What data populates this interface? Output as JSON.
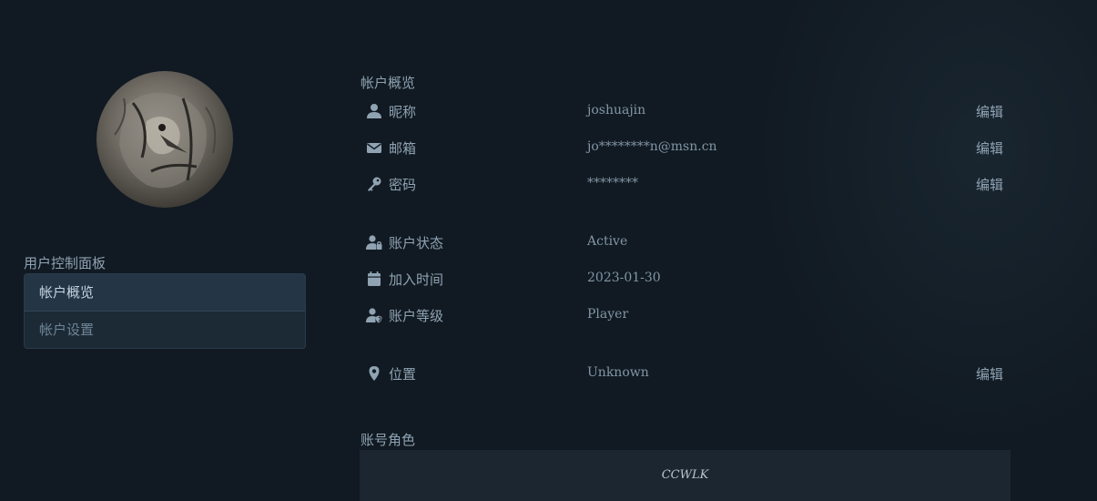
{
  "sidebar": {
    "panel_title": "用户控制面板",
    "items": [
      {
        "label": "帐户概览",
        "active": true
      },
      {
        "label": "帐户设置",
        "active": false
      }
    ]
  },
  "overview": {
    "title": "帐户概览",
    "edit_label": "编辑",
    "rows": [
      {
        "icon": "user-icon",
        "label": "昵称",
        "value": "joshuajin",
        "editable": true
      },
      {
        "icon": "envelope-icon",
        "label": "邮箱",
        "value": "jo********n@msn.cn",
        "editable": true
      },
      {
        "icon": "key-icon",
        "label": "密码",
        "value": "********",
        "editable": true
      },
      {
        "icon": "user-lock-icon",
        "label": "账户状态",
        "value": "Active",
        "editable": false
      },
      {
        "icon": "calendar-icon",
        "label": "加入时间",
        "value": "2023-01-30",
        "editable": false
      },
      {
        "icon": "user-shield-icon",
        "label": "账户等级",
        "value": "Player",
        "editable": false
      },
      {
        "icon": "map-marker-icon",
        "label": "位置",
        "value": "Unknown",
        "editable": true
      }
    ]
  },
  "roles": {
    "title": "账号角色",
    "items": [
      "CCWLK"
    ]
  },
  "colors": {
    "background": "#111a22",
    "text": "#8fa3b3",
    "nav_active": "#243646",
    "role_box": "#1b2630"
  }
}
